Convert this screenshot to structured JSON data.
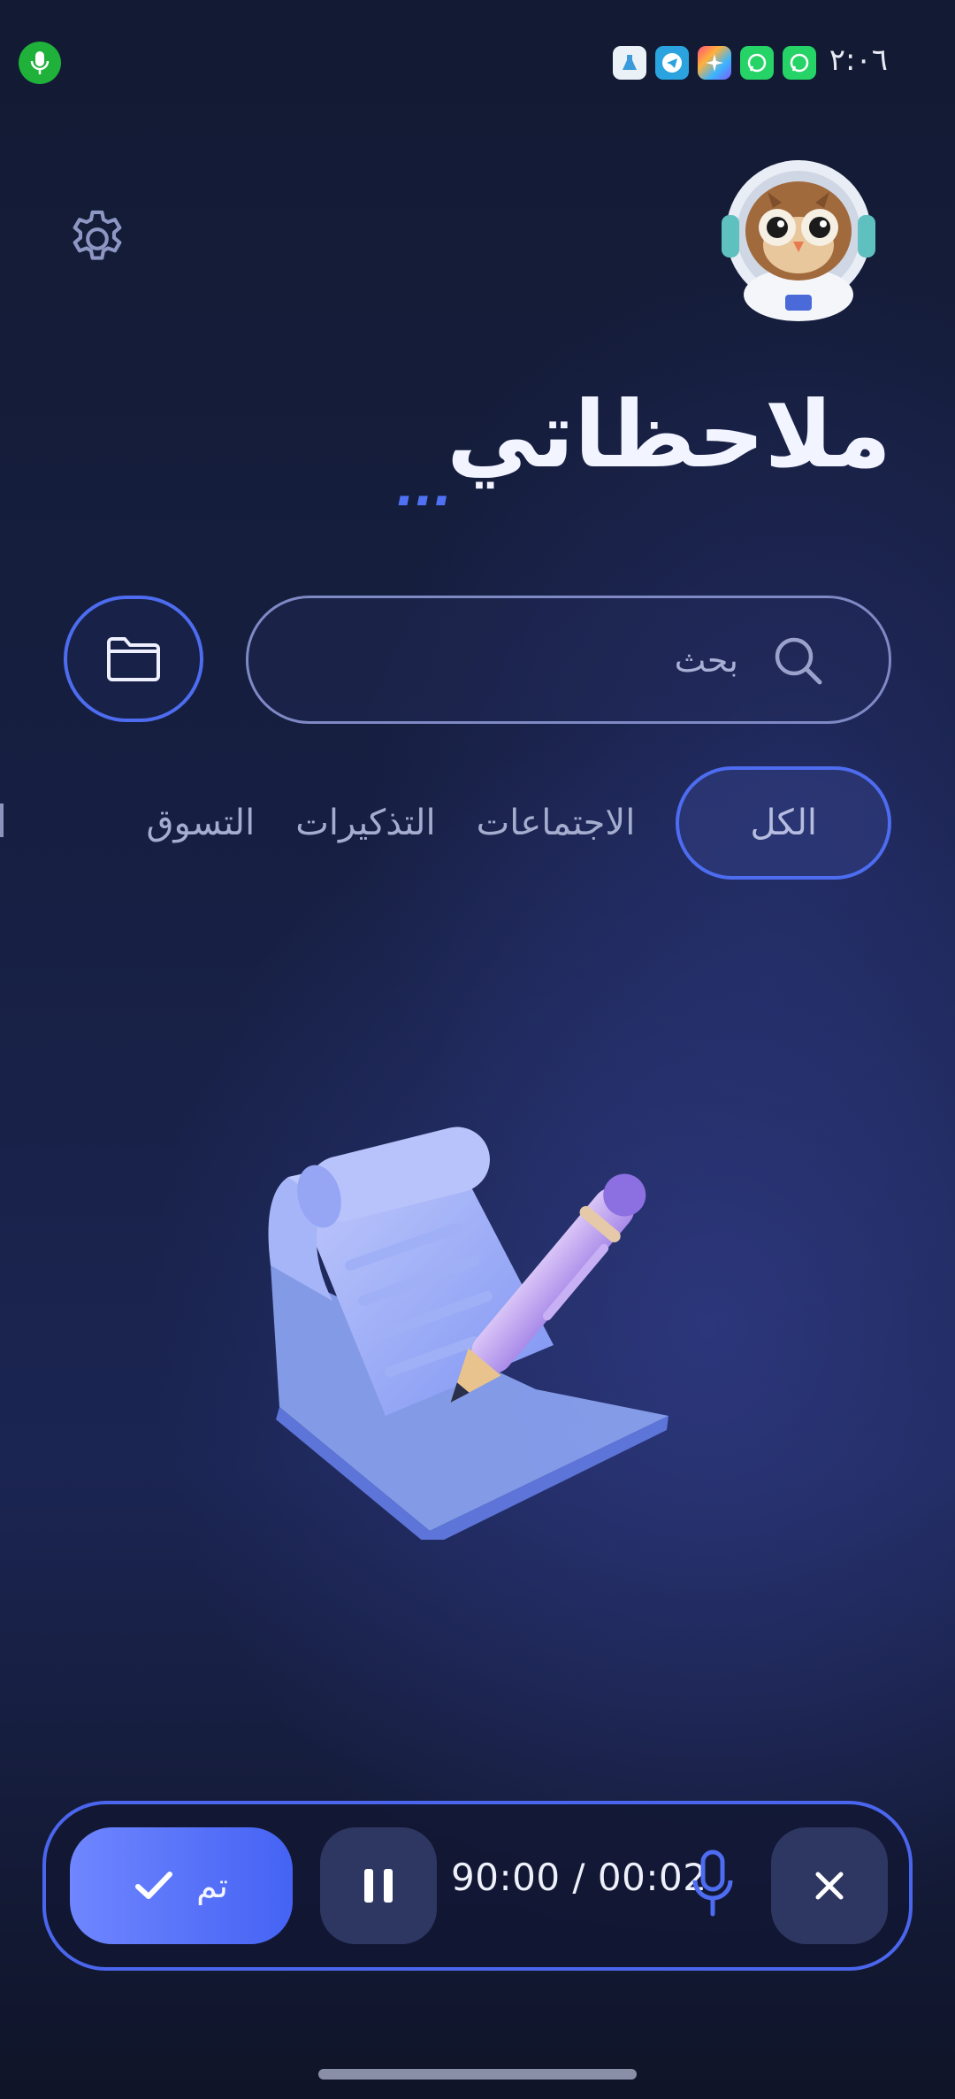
{
  "status_bar": {
    "time": "٢:٠٦",
    "notification_icons": [
      "lab-app-icon",
      "telegram-icon",
      "gallery-icon",
      "whatsapp-icon",
      "whatsapp-business-icon"
    ]
  },
  "header": {
    "title": "ملاحظاتي",
    "title_decoration": "..."
  },
  "search": {
    "placeholder": "بحث"
  },
  "categories": [
    {
      "label": "الكل",
      "active": true
    },
    {
      "label": "الاجتماعات",
      "active": false
    },
    {
      "label": "التذكيرات",
      "active": false
    },
    {
      "label": "التسوق",
      "active": false
    }
  ],
  "recorder": {
    "done_label": "تم",
    "elapsed": "00:02",
    "limit": "90:00",
    "timer_text": "90:00 / 00:02"
  },
  "colors": {
    "accent": "#4d6cf0",
    "mic_indicator": "#1fb13a",
    "background": "#172044"
  }
}
